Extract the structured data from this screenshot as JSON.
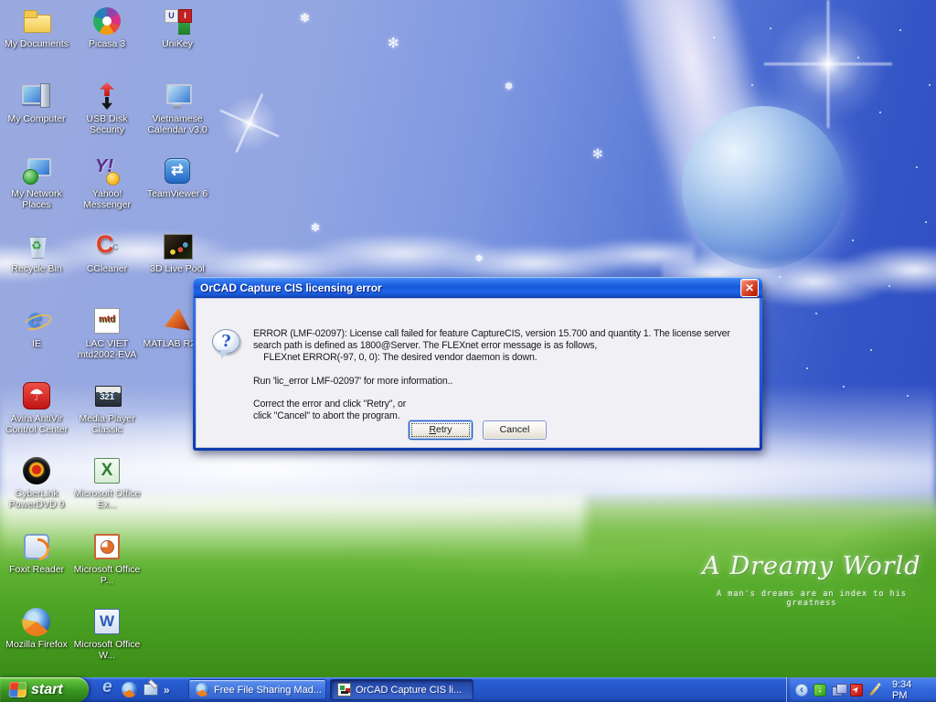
{
  "wallpaper": {
    "title": "A Dreamy World",
    "subtitle": "A man's dreams are an index to his greatness"
  },
  "desktop_icons": [
    {
      "label": "My Documents",
      "icon": "my-documents-folder-icon"
    },
    {
      "label": "Picasa 3",
      "icon": "picasa-pinwheel-icon"
    },
    {
      "label": "UniKey",
      "icon": "unikey-icon"
    },
    {
      "label": "My Computer",
      "icon": "my-computer-icon"
    },
    {
      "label": "USB Disk Security",
      "icon": "usb-disk-security-arrows-icon"
    },
    {
      "label": "Vietnamese Calendar v3.0",
      "icon": "vietnamese-calendar-monitor-icon"
    },
    {
      "label": "My Network Places",
      "icon": "my-network-places-icon"
    },
    {
      "label": "Yahoo! Messenger",
      "icon": "yahoo-messenger-icon"
    },
    {
      "label": "TeamViewer 6",
      "icon": "teamviewer-icon"
    },
    {
      "label": "Recycle Bin",
      "icon": "recycle-bin-icon"
    },
    {
      "label": "CCleaner",
      "icon": "ccleaner-icon"
    },
    {
      "label": "3D Live Pool",
      "icon": "3d-live-pool-icon"
    },
    {
      "label": "IE",
      "icon": "internet-explorer-icon"
    },
    {
      "label": "LAC VIET mtd2002-EVA",
      "icon": "lac-viet-dictionary-icon"
    },
    {
      "label": "MATLAB R2010",
      "icon": "matlab-icon"
    },
    {
      "label": "Avira AntiVir Control Center",
      "icon": "avira-umbrella-icon"
    },
    {
      "label": "Media Player Classic",
      "icon": "media-player-classic-icon"
    },
    {
      "label": "CyberLink PowerDVD 9",
      "icon": "powerdvd-icon"
    },
    {
      "label": "Microsoft Office Ex...",
      "icon": "excel-icon"
    },
    {
      "label": "Foxit Reader",
      "icon": "foxit-reader-icon"
    },
    {
      "label": "Microsoft Office P...",
      "icon": "powerpoint-icon"
    },
    {
      "label": "Mozilla Firefox",
      "icon": "firefox-icon"
    },
    {
      "label": "Microsoft Office W...",
      "icon": "word-icon"
    }
  ],
  "dialog": {
    "title": "OrCAD Capture CIS licensing error",
    "lines": [
      "ERROR (LMF-02097): License call failed for feature CaptureCIS, version 15.700 and quantity 1. The license server",
      "search path is defined as 1800@Server. The FLEXnet error message is as follows,",
      "    FLEXnet ERROR(-97, 0, 0): The desired vendor daemon is down.",
      "",
      "Run 'lic_error LMF-02097' for more information..",
      "",
      "Correct the error and click \"Retry\", or",
      "click \"Cancel\" to abort the program."
    ],
    "buttons": {
      "retry": "Retry",
      "retry_accel": "R",
      "retry_rest": "etry",
      "cancel": "Cancel"
    }
  },
  "taskbar": {
    "start": "start",
    "overflow_chevron": "»",
    "quick_launch": [
      "internet-explorer",
      "firefox",
      "show-desktop"
    ],
    "window_buttons": [
      {
        "label": "Free File Sharing Mad...",
        "icon": "firefox",
        "active": false
      },
      {
        "label": "OrCAD Capture CIS li...",
        "icon": "orcad",
        "active": true
      }
    ],
    "tray": {
      "collapse_glyph": "‹",
      "icons": [
        "hide-icons-chevron",
        "idm-downloader",
        "display-settings",
        "remote-cursor",
        "magic-wand"
      ],
      "time": "9:34 PM"
    }
  },
  "colors": {
    "taskbar_blue": "#2456c8",
    "start_green": "#3f9e27",
    "titlebar_blue": "#1659dd",
    "dialog_body": "#f1f0f5",
    "grass_green": "#54a82a",
    "sky_periwinkle": "#93a6e2",
    "deep_sky_blue": "#2b4cc2",
    "close_red": "#ba2408"
  }
}
